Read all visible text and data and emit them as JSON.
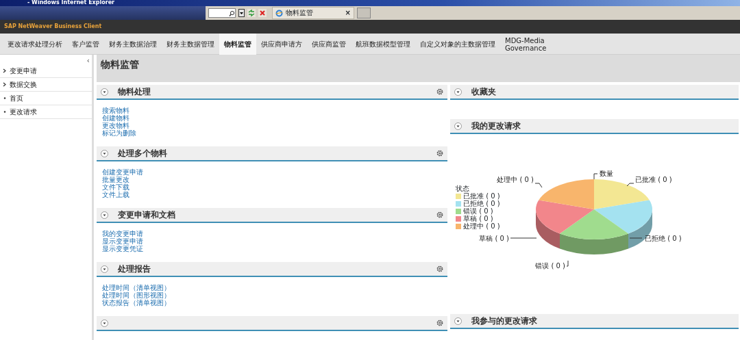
{
  "window": {
    "title": "- Windows Internet Explorer"
  },
  "browser": {
    "tab": "物料监管",
    "close": "×"
  },
  "app_title": "SAP NetWeaver Business Client",
  "nav_tabs": [
    {
      "label": "更改请求处理分析",
      "selected": false
    },
    {
      "label": "客户监管",
      "selected": false
    },
    {
      "label": "财务主数据治理",
      "selected": false
    },
    {
      "label": "财务主数据管理",
      "selected": false
    },
    {
      "label": "物料监管",
      "selected": true
    },
    {
      "label": "供应商申请方",
      "selected": false
    },
    {
      "label": "供应商监管",
      "selected": false
    },
    {
      "label": "航班数据模型管理",
      "selected": false
    },
    {
      "label": "自定义对象的主数据管理",
      "selected": false
    },
    {
      "label": "MDG-Media Governance",
      "selected": false
    }
  ],
  "sidebar": {
    "collapse": "‹",
    "items": [
      {
        "label": "变更申请",
        "kind": "folder"
      },
      {
        "label": "数据交换",
        "kind": "folder"
      },
      {
        "label": "首页",
        "kind": "page"
      },
      {
        "label": "更改请求",
        "kind": "page"
      }
    ]
  },
  "page_title": "物料监管",
  "left_sections": [
    {
      "title": "物料处理",
      "links": [
        "搜索物料",
        "创建物料",
        "更改物料",
        "标记为删除"
      ]
    },
    {
      "title": "处理多个物料",
      "links": [
        "创建变更申请",
        "批量更改",
        "文件下载",
        "文件上载"
      ]
    },
    {
      "title": "变更申请和文档",
      "links": [
        "我的变更申请",
        "显示变更申请",
        "显示变更凭证"
      ]
    },
    {
      "title": "处理报告",
      "links": [
        "处理时间（清单视图）",
        "处理时间（图形视图）",
        "状态报告（清单视图）"
      ]
    }
  ],
  "cut_off_section": true,
  "favorites": {
    "title": "收藏夹"
  },
  "my_requests": {
    "title": "我的更改请求",
    "chart_title": "数量",
    "legend_title": "状态",
    "legend": [
      {
        "label": "已批准 ( 0 )",
        "color": "#f3e793"
      },
      {
        "label": "已拒绝 ( 0 )",
        "color": "#a4e2f0"
      },
      {
        "label": "错误 ( 0 )",
        "color": "#a0dc8e"
      },
      {
        "label": "草稿 ( 0 )",
        "color": "#f2868b"
      },
      {
        "label": "处理中 ( 0 )",
        "color": "#f8b56c"
      }
    ],
    "slice_labels": [
      "已批准 ( 0 )",
      "已拒绝 ( 0 )",
      "错误 ( 0 )",
      "草稿 ( 0 )",
      "处理中 ( 0 )"
    ]
  },
  "participated": {
    "title": "我参与的更改请求"
  }
}
